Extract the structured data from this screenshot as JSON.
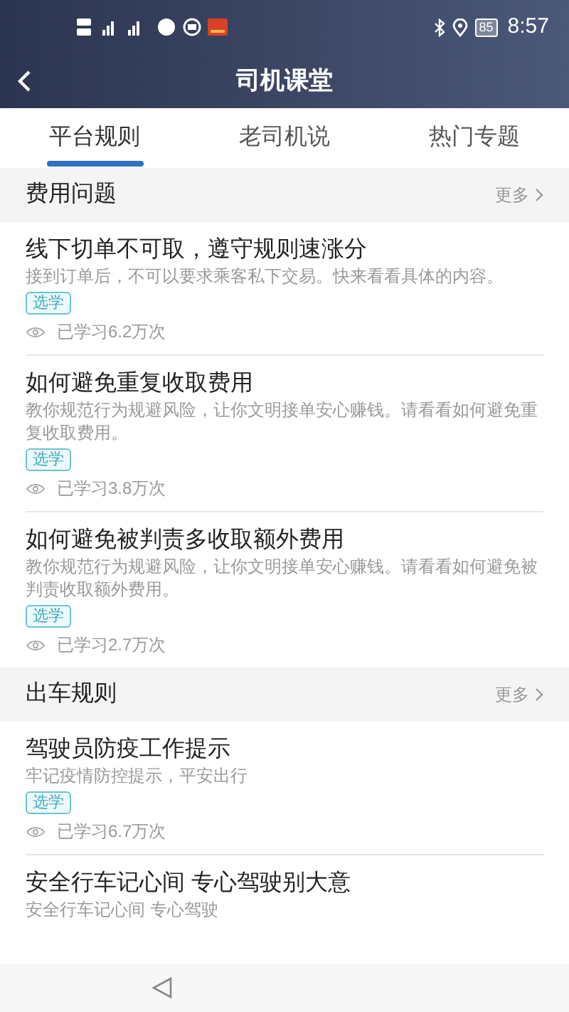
{
  "status_bar": {
    "battery": "85",
    "time": "8:57"
  },
  "header": {
    "title": "司机课堂"
  },
  "tabs": [
    {
      "label": "平台规则",
      "selected": true
    },
    {
      "label": "老司机说",
      "selected": false
    },
    {
      "label": "热门专题",
      "selected": false
    }
  ],
  "sections": [
    {
      "title": "费用问题",
      "more": "更多",
      "articles": [
        {
          "title": "线下切单不可取，遵守规则速涨分",
          "description": "接到订单后，不可以要求乘客私下交易。快来看看具体的内容。",
          "tag": "选学",
          "views": "已学习6.2万次"
        },
        {
          "title": "如何避免重复收取费用",
          "description": "教你规范行为规避风险，让你文明接单安心赚钱。请看看如何避免重复收取费用。",
          "tag": "选学",
          "views": "已学习3.8万次"
        },
        {
          "title": "如何避免被判责多收取额外费用",
          "description": "教你规范行为规避风险，让你文明接单安心赚钱。请看看如何避免被判责收取额外费用。",
          "tag": "选学",
          "views": "已学习2.7万次"
        }
      ]
    },
    {
      "title": "出车规则",
      "more": "更多",
      "articles": [
        {
          "title": "驾驶员防疫工作提示",
          "description": "牢记疫情防控提示，平安出行",
          "tag": "选学",
          "views": "已学习6.7万次"
        },
        {
          "title": "安全行车记心间 专心驾驶别大意",
          "description": "安全行车记心间 专心驾驶"
        }
      ]
    }
  ]
}
